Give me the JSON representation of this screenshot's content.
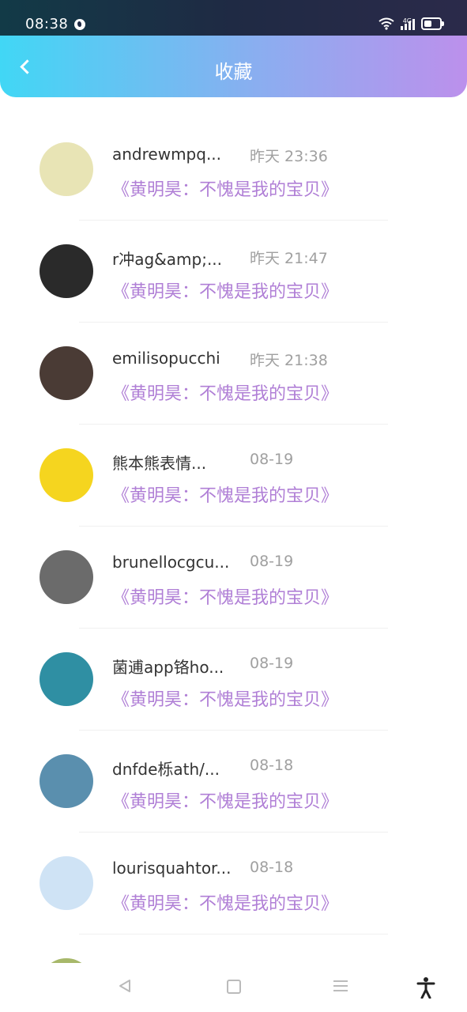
{
  "status_bar": {
    "time": "08:38",
    "network": "4G"
  },
  "header": {
    "title": "收藏",
    "back_icon": "chevron-left-icon"
  },
  "list": [
    {
      "name": "andrewmpq...",
      "time": "昨天 23:36",
      "content": "《黄明昊：不愧是我的宝贝》",
      "avatar_color": "#e8e4b5"
    },
    {
      "name": "r冲ag&amp;...",
      "time": "昨天 21:47",
      "content": "《黄明昊：不愧是我的宝贝》",
      "avatar_color": "#2a2a2a"
    },
    {
      "name": "emilisopucchi",
      "time": "昨天 21:38",
      "content": "《黄明昊：不愧是我的宝贝》",
      "avatar_color": "#4a3b35"
    },
    {
      "name": "熊本熊表情...",
      "time": "08-19",
      "content": "《黄明昊：不愧是我的宝贝》",
      "avatar_color": "#f5d51f"
    },
    {
      "name": "brunellocgcu...",
      "time": "08-19",
      "content": "《黄明昊：不愧是我的宝贝》",
      "avatar_color": "#6b6b6b"
    },
    {
      "name": "菌逋app铬ho...",
      "time": "08-19",
      "content": "《黄明昊：不愧是我的宝贝》",
      "avatar_color": "#2f8fa3"
    },
    {
      "name": "dnfde栎ath/...",
      "time": "08-18",
      "content": "《黄明昊：不愧是我的宝贝》",
      "avatar_color": "#5a8fae"
    },
    {
      "name": "lourisquahtor...",
      "time": "08-18",
      "content": "《黄明昊：不愧是我的宝贝》",
      "avatar_color": "#cfe3f5"
    },
    {
      "name": "",
      "time": "",
      "content": "",
      "avatar_color": "#a7b86a"
    }
  ],
  "nav": {
    "back": "triangle-back-icon",
    "home": "square-home-icon",
    "menu": "menu-icon",
    "accessibility": "accessibility-icon"
  }
}
